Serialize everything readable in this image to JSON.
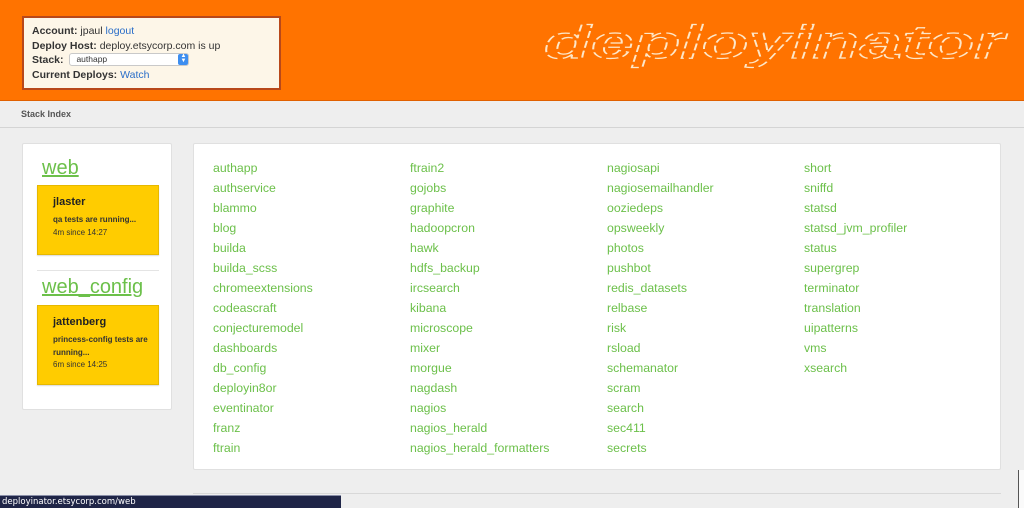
{
  "header": {
    "account_label": "Account:",
    "account_user": "jpaul",
    "logout_link": "logout",
    "deploy_host_label": "Deploy Host:",
    "deploy_host_value": "deploy.etsycorp.com is up",
    "stack_label": "Stack:",
    "stack_selected": "authapp",
    "current_deploys_label": "Current Deploys:",
    "watch_link": "Watch",
    "logo_text": "deployinator"
  },
  "subnav": {
    "breadcrumb": "Stack Index"
  },
  "current_deploys": [
    {
      "stack": "web",
      "user": "jlaster",
      "message": "qa tests are running...",
      "since": "4m since 14:27"
    },
    {
      "stack": "web_config",
      "user": "jattenberg",
      "message": "princess-config tests are running...",
      "since": "6m since 14:25"
    }
  ],
  "stacks": {
    "columns": [
      [
        "authapp",
        "authservice",
        "blammo",
        "blog",
        "builda",
        "builda_scss",
        "chromeextensions",
        "codeascraft",
        "conjecturemodel",
        "dashboards",
        "db_config",
        "deployin8or",
        "eventinator",
        "franz",
        "ftrain"
      ],
      [
        "ftrain2",
        "gojobs",
        "graphite",
        "hadoopcron",
        "hawk",
        "hdfs_backup",
        "ircsearch",
        "kibana",
        "microscope",
        "mixer",
        "morgue",
        "nagdash",
        "nagios",
        "nagios_herald",
        "nagios_herald_formatters"
      ],
      [
        "nagiosapi",
        "nagiosemailhandler",
        "ooziedeps",
        "opsweekly",
        "photos",
        "pushbot",
        "redis_datasets",
        "relbase",
        "risk",
        "rsload",
        "schemanator",
        "scram",
        "search",
        "sec411",
        "secrets"
      ],
      [
        "short",
        "sniffd",
        "statsd",
        "statsd_jvm_profiler",
        "status",
        "supergrep",
        "terminator",
        "translation",
        "uipatterns",
        "vms",
        "xsearch"
      ]
    ]
  },
  "statusbar": {
    "url": "deployinator.etsycorp.com/web"
  },
  "colors": {
    "header_orange": "#ff7300",
    "link_green": "#6cc04a",
    "deploy_card_yellow": "#ffcc00",
    "link_blue": "#2a6ec8"
  }
}
